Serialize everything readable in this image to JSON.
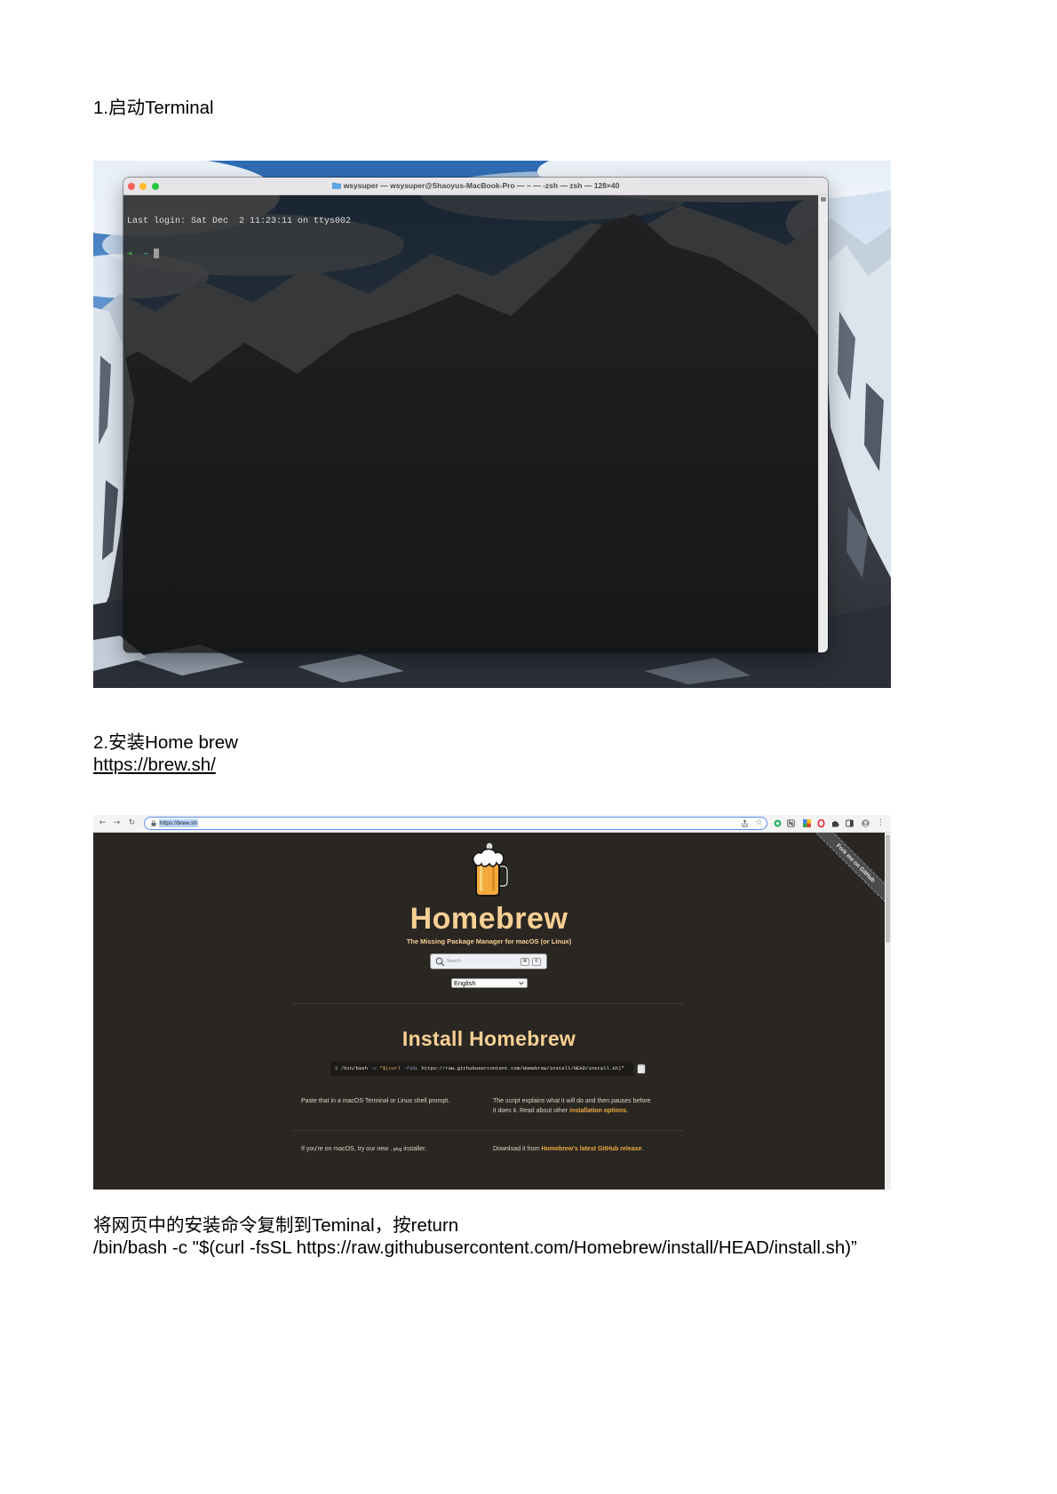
{
  "document": {
    "step1_heading": "1.启动Terminal",
    "step2_heading": "2.安装Home brew",
    "step2_link": "https://brew.sh/",
    "step3_instruction": "将网页中的安装命令复制到Teminal，按return",
    "step3_command": "/bin/bash -c \"$(curl -fsSL https://raw.githubusercontent.com/Homebrew/install/HEAD/install.sh)”"
  },
  "terminal": {
    "window_title": "wsysuper — wsysuper@Shaoyus-MacBook-Pro — ~ — -zsh — zsh — 128×40",
    "last_login_line": "Last login: Sat Dec  2 11:23:11 on ttys002",
    "prompt_arrow": "➜",
    "prompt_dir": "~"
  },
  "browser": {
    "url": "https://brew.sh",
    "fork_ribbon": "Fork me on GitHub",
    "site_title": "Homebrew",
    "tagline": "The Missing Package Manager for macOS (or Linux)",
    "search_placeholder": "Search",
    "search_keys": [
      "⌘",
      "K"
    ],
    "language_selected": "English",
    "install_heading": "Install Homebrew",
    "install_command": [
      "$",
      "/bin/bash",
      "-c",
      "\"$(curl",
      "-fsSL",
      "https://raw.githubusercontent.com/Homebrew/install/HEAD/install.sh)\""
    ],
    "paste_text": "Paste that in a macOS Terminal or Linux shell prompt.",
    "script_line1": "The script explains what it will do and then pauses before",
    "script_line2_prefix": "it does it. Read about other ",
    "script_link": "installation options",
    "script_suffix": ".",
    "pkg_prefix": "If you're on macOS, try our new ",
    "pkg_code": ".pkg",
    "pkg_suffix": " installer.",
    "download_prefix": "Download it from ",
    "download_link": "Homebrew's latest GitHub release",
    "download_suffix": "."
  },
  "icons": {
    "terminal": [
      "close-light-icon",
      "minimize-light-icon",
      "zoom-light-icon",
      "folder-icon"
    ],
    "browser_toolbar": [
      "back-arrow-icon",
      "forward-arrow-icon",
      "reload-icon",
      "lock-icon",
      "share-icon",
      "bookmark-star-icon",
      "extension-green-icon",
      "extension-notes-icon",
      "extension-colorful-icon",
      "extension-red-o-icon",
      "extensions-puzzle-icon",
      "side-panel-icon",
      "profile-avatar-icon",
      "more-menu-icon"
    ],
    "brew_page": [
      "homebrew-logo-icon",
      "search-icon",
      "chevron-down-icon",
      "copy-icon"
    ]
  },
  "colors": {
    "page_bg": "#ffffff",
    "doc_text": "#000000",
    "brew_bg": "#2a2723",
    "brew_heading": "#f9d094",
    "brew_text": "#ddd3c3",
    "brew_link": "#eda93f",
    "terminal_prompt_green": "#3fc23f",
    "terminal_prompt_cyan": "#49c0c8",
    "url_focus_ring": "#5b8def"
  }
}
